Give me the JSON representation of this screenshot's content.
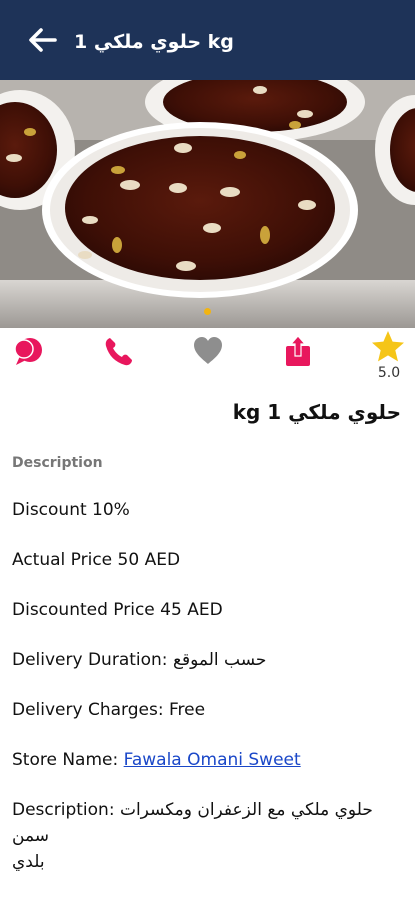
{
  "appbar": {
    "title": "حلوي ملكي 1 kg"
  },
  "hero": {
    "carousel_pages": 1,
    "active_page": 1,
    "indicator_color": "#f2b411"
  },
  "actions": {
    "chat_icon": "chat-bubble-icon",
    "call_icon": "phone-icon",
    "favorite_icon": "heart-icon",
    "share_icon": "share-icon",
    "rating_icon": "star-icon",
    "rating_value": "5.0",
    "accent_color": "#e8175d",
    "star_color": "#f5c518"
  },
  "product": {
    "title": "حلوي ملكي 1 kg"
  },
  "details": {
    "section_label": "Description",
    "discount": "Discount 10%",
    "actual_price": "Actual Price 50 AED",
    "discounted_price": "Discounted Price 45 AED",
    "delivery_duration": "Delivery Duration: حسب الموقع",
    "delivery_charges": "Delivery Charges: Free",
    "store_label": "Store Name: ",
    "store_name": " Fawala Omani Sweet ",
    "description_line1": "Description: حلوي ملكي مع الزعفران ومكسرات سمن",
    "description_line2": "بلدي"
  }
}
